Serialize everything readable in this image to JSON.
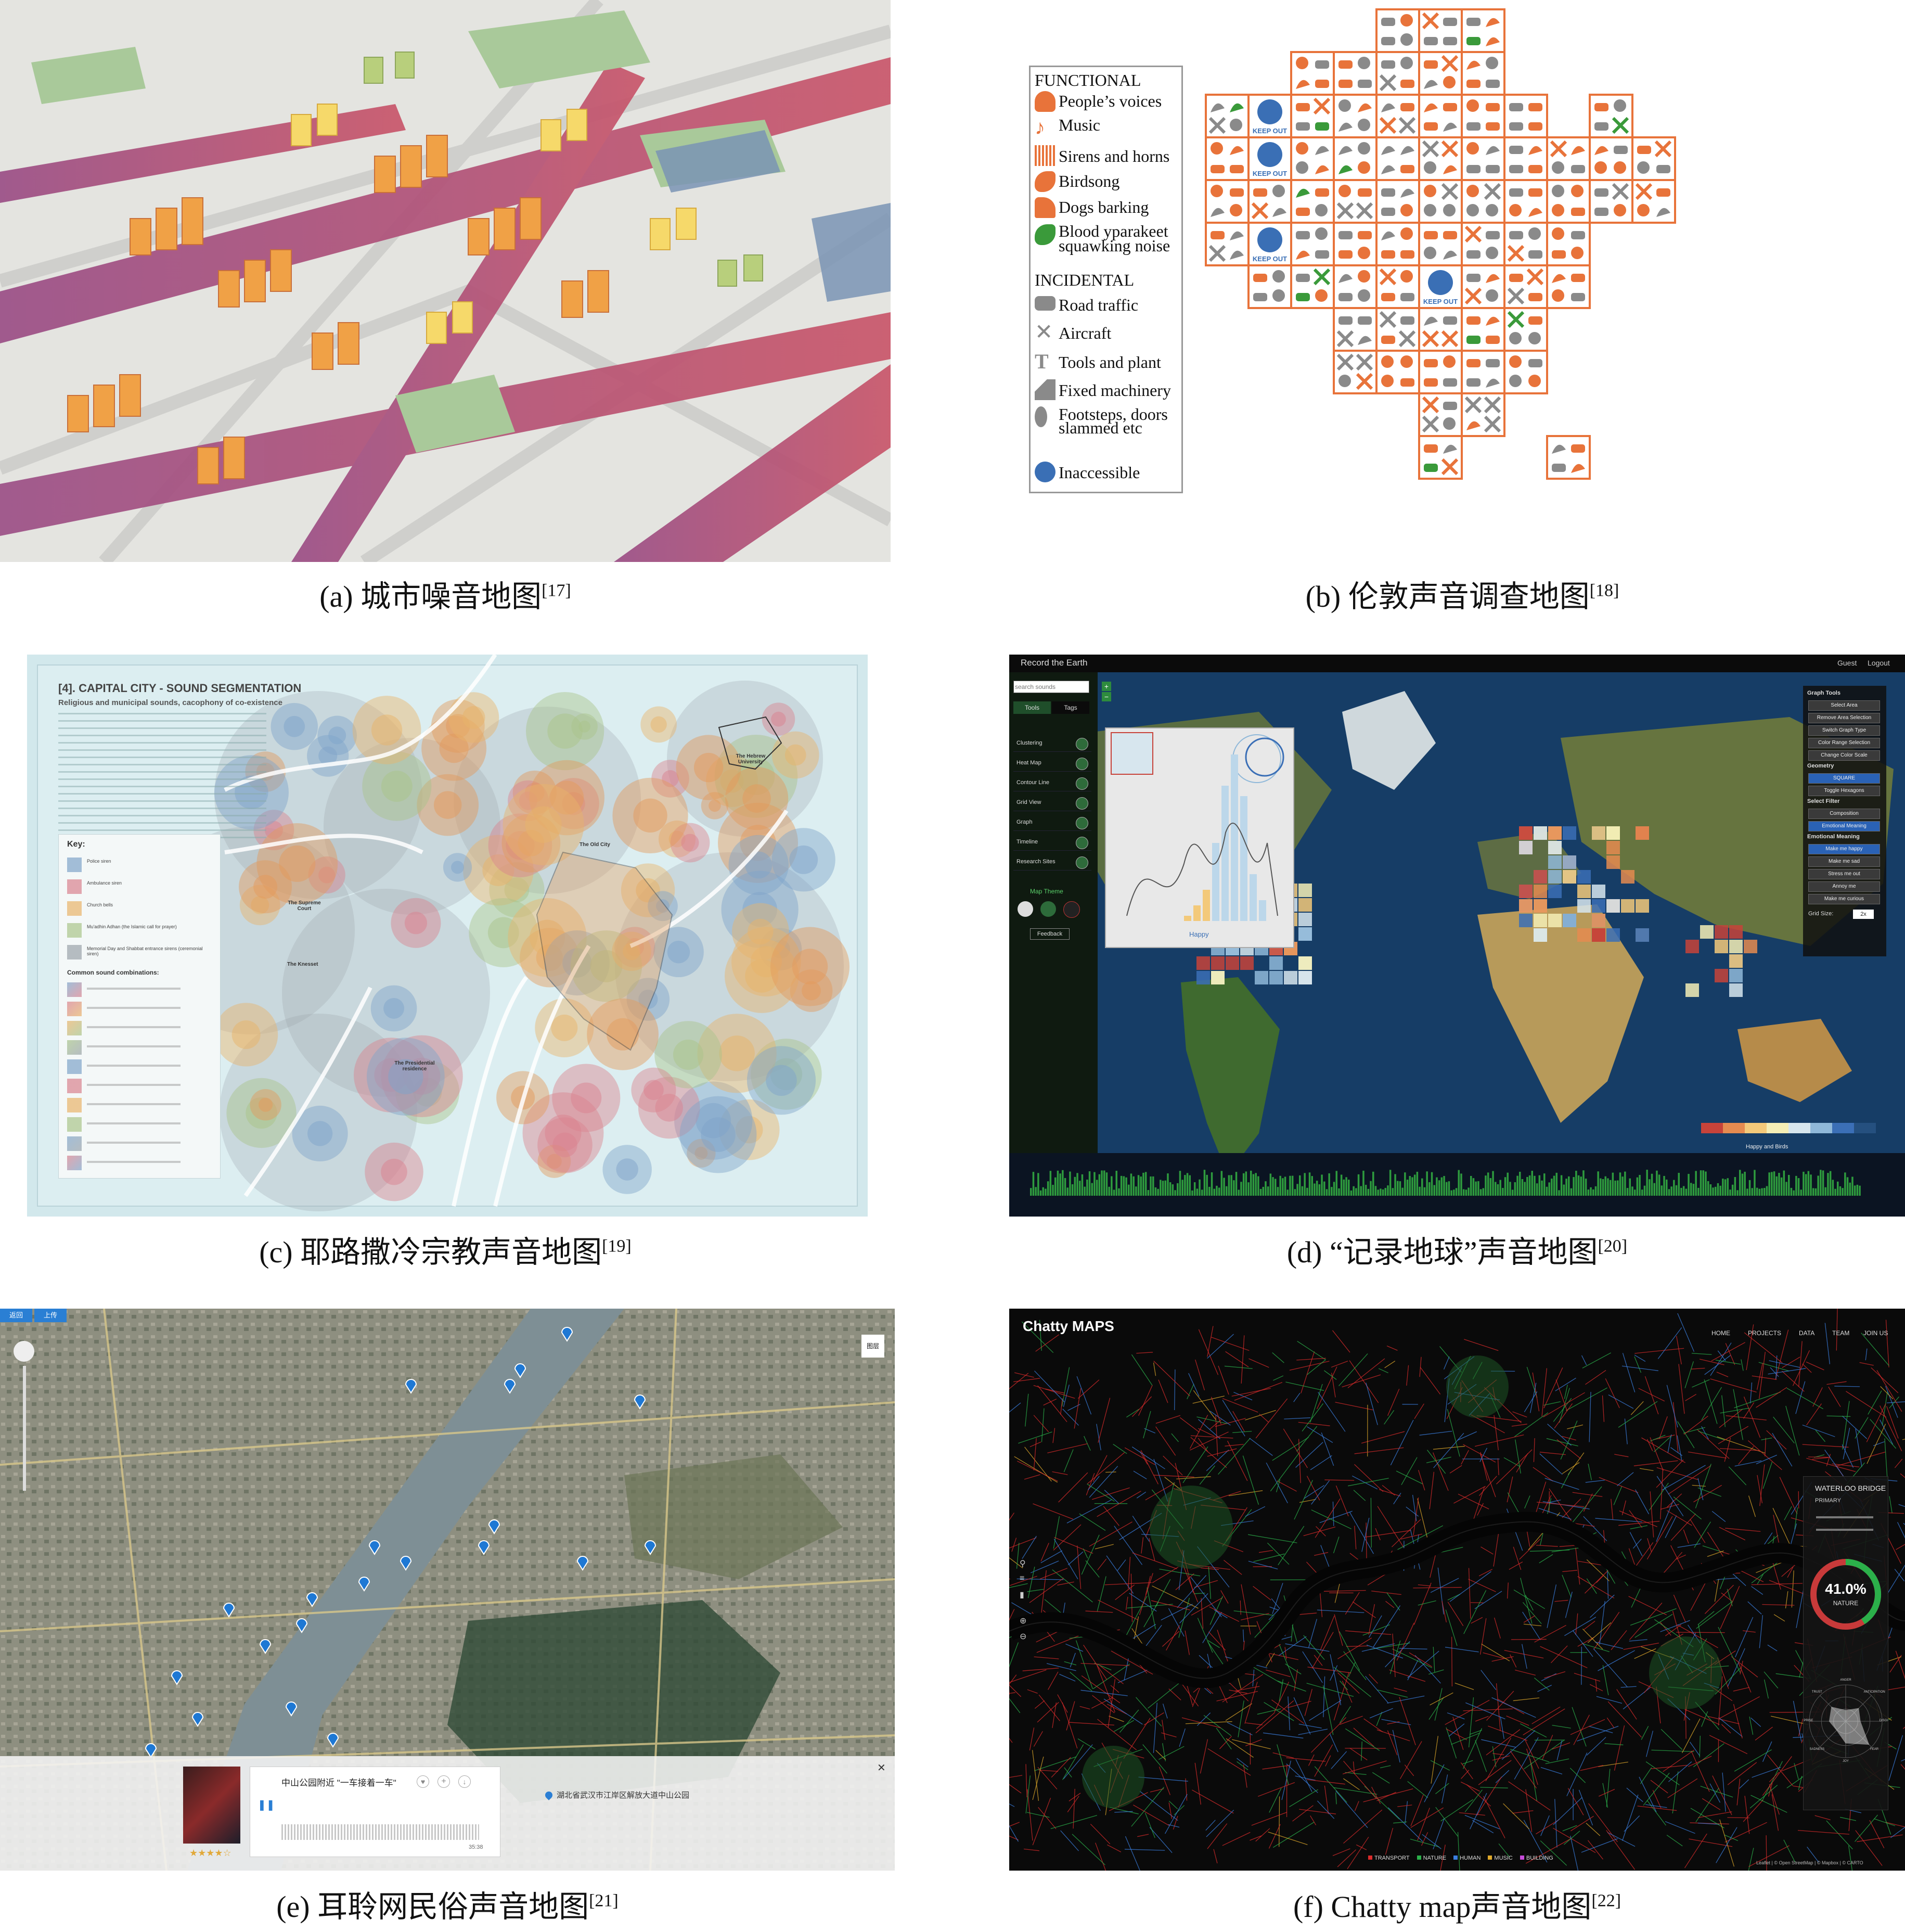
{
  "captions": {
    "a": {
      "text": "(a) 城市噪音地图",
      "ref": "[17]"
    },
    "b": {
      "text": "(b) 伦敦声音调查地图",
      "ref": "[18]"
    },
    "c": {
      "text": "(c) 耶路撒冷宗教声音地图",
      "ref": "[19]"
    },
    "d": {
      "text": "(d) “记录地球”声音地图",
      "ref": "[20]"
    },
    "e": {
      "text": "(e) 耳聆网民俗声音地图",
      "ref": "[21]"
    },
    "f": {
      "text": "(f) Chatty map声音地图",
      "ref": "[22]"
    }
  },
  "panel_b": {
    "functional_title": "FUNCTIONAL",
    "functional": [
      "People’s voices",
      "Music",
      "Sirens and horns",
      "Birdsong",
      "Dogs barking",
      "Blood yparakeet",
      "squawking noise"
    ],
    "incidental_title": "INCIDENTAL",
    "incidental": [
      "Road traffic",
      "Aircraft",
      "Tools and plant",
      "Fixed machinery",
      "Footsteps, doors",
      "slammed etc"
    ],
    "inaccessible": "Inaccessible",
    "keep_out": "KEEP OUT",
    "colors": {
      "functional": "#e8733a",
      "incidental": "#8a8a8a",
      "parakeet": "#3a9a3a",
      "keepout": "#3a6fb5"
    }
  },
  "panel_c": {
    "title": "[4]. CAPITAL CITY - SOUND SEGMENTATION",
    "subtitle": "Religious and municipal sounds, cacophony of co-existence",
    "key_title": "Key:",
    "key_items": [
      "Police siren",
      "Ambulance siren",
      "Church bells",
      "Mu'adhin Adhan (the Islamic call for prayer)",
      "Memorial Day and Shabbat entrance sirens (ceremonial siren)"
    ],
    "combo_title": "Common sound combinations:",
    "places": [
      "The Supreme Court",
      "The Knesset",
      "The Old City",
      "The Hebrew University",
      "The Presidential residence"
    ]
  },
  "panel_d": {
    "brand": "Record the Earth",
    "search_placeholder": "search sounds",
    "tabs": [
      "Tools",
      "Tags"
    ],
    "tools": [
      "Clustering",
      "Heat Map",
      "Contour Line",
      "Grid View",
      "Graph",
      "Timeline",
      "Research Sites"
    ],
    "map_theme": "Map Theme",
    "feedback": "Feedback",
    "user_links": [
      "Guest",
      "Logout"
    ],
    "right_title": "Graph Tools",
    "right_buttons": [
      "Select Area",
      "Remove Area Selection",
      "Switch Graph Type",
      "Color Range Selection",
      "Change Color Scale"
    ],
    "geometry": "Geometry",
    "geometry_buttons": [
      "SQUARE",
      "Toggle Hexagons"
    ],
    "filter": "Select Filter",
    "filter_buttons": [
      "Composition",
      "Emotional Meaning"
    ],
    "emotional": "Emotional Meaning",
    "emotional_buttons": [
      "Make me happy",
      "Make me sad",
      "Stress me out",
      "Annoy me",
      "Make me curious"
    ],
    "grid_size_label": "Grid Size:",
    "grid_size": "2x",
    "graph_label": "Happy",
    "legend_label": "Happy and Birds"
  },
  "panel_e": {
    "nav": [
      "返回",
      "上传"
    ],
    "track_title": "中山公园附近 \"一车接着一车\"",
    "location": "湖北省武汉市江岸区解放大道中山公园",
    "duration": "35:38",
    "layer_btn": "图层"
  },
  "panel_f": {
    "logo": "Chatty MAPS",
    "nav": [
      "HOME",
      "PROJECTS",
      "DATA",
      "TEAM",
      "JOIN US"
    ],
    "street": "WATERLOO BRIDGE",
    "street_type": "PRIMARY",
    "percent": "41.0%",
    "category": "NATURE",
    "radar_labels": [
      "ANGER",
      "ANTICIPATION",
      "DISGUST",
      "FEAR",
      "JOY",
      "SADNESS",
      "SURPRISE",
      "TRUST"
    ],
    "legend": [
      "TRANSPORT",
      "NATURE",
      "HUMAN",
      "MUSIC",
      "BUILDING"
    ],
    "legend_colors": [
      "#d92b2b",
      "#2bb04a",
      "#3a7fe0",
      "#e0a92b",
      "#c64bd9"
    ],
    "credit": "Leaflet | © Open StreetMap | © Mapbox | © CARTO"
  }
}
